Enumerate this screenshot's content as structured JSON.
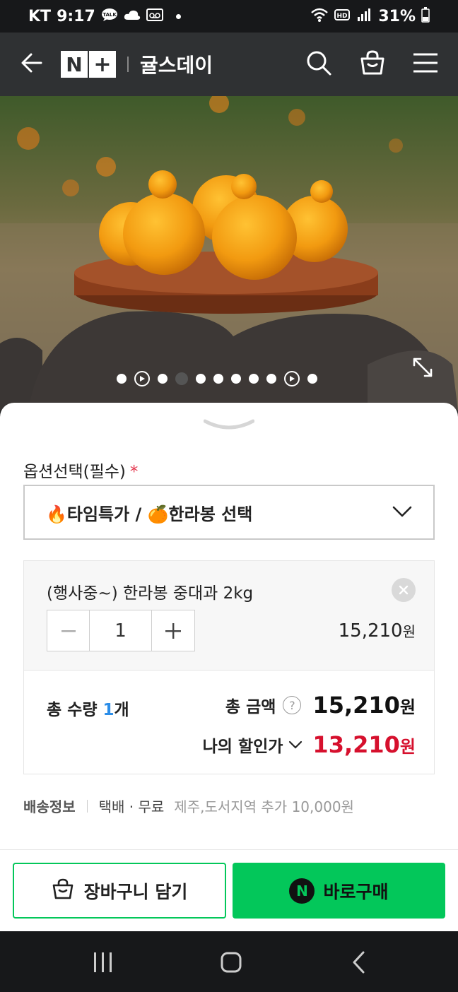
{
  "status_bar": {
    "carrier": "KT",
    "time": "9:17",
    "battery": "31%",
    "icons": [
      "talk-icon",
      "cloud-icon",
      "voicemail-icon",
      "dot-icon",
      "wifi-icon",
      "hd-icon",
      "signal-icon",
      "battery-icon"
    ]
  },
  "header": {
    "logo_n": "N",
    "logo_plus": "+",
    "store_name": "귤스데이"
  },
  "carousel": {
    "total_dots": 11,
    "active_index": 3,
    "play_indices": [
      1,
      9
    ]
  },
  "options": {
    "label": "옵션선택(필수)",
    "required_mark": "*",
    "selected": "🔥타임특가 / 🍊한라봉 선택"
  },
  "item": {
    "name": "(행사중~) 한라봉 중대과 2kg",
    "quantity": "1",
    "price": "15,210",
    "currency": "원"
  },
  "totals": {
    "qty_label": "총 수량",
    "qty_value": "1",
    "qty_unit": "개",
    "amount_label": "총 금액",
    "help": "?",
    "amount_value": "15,210",
    "currency": "원",
    "discount_label": "나의 할인가",
    "discount_value": "13,210"
  },
  "shipping": {
    "label": "배송정보",
    "method": "택배 · 무료",
    "note": "제주,도서지역 추가 10,000원"
  },
  "actions": {
    "cart_label": "장바구니 담기",
    "buy_badge": "N",
    "buy_label": "바로구매"
  },
  "colors": {
    "naver_green": "#03c75a",
    "discount_red": "#d6102d",
    "qty_blue": "#2b8de8",
    "header_bg": "#2f3133"
  }
}
